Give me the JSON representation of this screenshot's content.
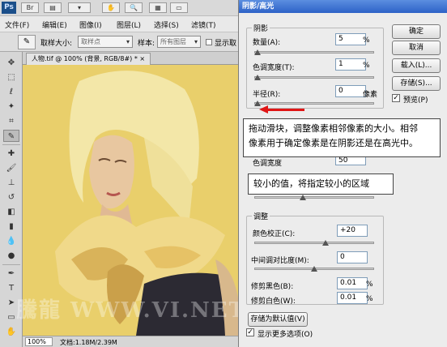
{
  "app": {
    "logo": "Ps",
    "menu": [
      "文件(F)",
      "编辑(E)",
      "图像(I)",
      "图层(L)",
      "选择(S)",
      "滤镜(T)"
    ]
  },
  "options": {
    "sample_size_label": "取样大小:",
    "sample_size_value": "取样点",
    "sample_label": "样本:",
    "sample_value": "所有图层",
    "show_ring_label": "显示取"
  },
  "document": {
    "tab_title": "人物.tif @ 100% (背景, RGB/8#) *",
    "zoom": "100%",
    "info": "文档:1.18M/2.39M"
  },
  "dialog": {
    "title": "阴影/高光",
    "shadow_group": "阴影",
    "amount_label": "数量(A):",
    "amount_value": "5",
    "amount_unit": "%",
    "tonal_label": "色调宽度(T):",
    "tonal_value": "1",
    "tonal_unit": "%",
    "radius_label": "半径(R):",
    "radius_value": "0",
    "radius_unit": "像素",
    "hl_partial_label": "色调宽度",
    "hl_partial_value": "50",
    "adjust_group": "调整",
    "color_label": "颜色校正(C):",
    "color_value": "+20",
    "midtone_label": "中间调对比度(M):",
    "midtone_value": "0",
    "black_clip_label": "修剪黑色(B):",
    "black_clip_value": "0.01",
    "black_clip_unit": "%",
    "white_clip_label": "修剪白色(W):",
    "white_clip_value": "0.01",
    "white_clip_unit": "%",
    "save_default": "存储为默认值(V)",
    "show_more": "显示更多选项(O)",
    "buttons": {
      "ok": "确定",
      "cancel": "取消",
      "load": "载入(L)...",
      "save": "存储(S)...",
      "preview": "预览(P)"
    }
  },
  "annotations": {
    "callout1_line1": "拖动滑块，调整像素相邻像素的大小。相邻",
    "callout1_line2": "像素用于确定像素是在阴影还是在高光中。",
    "callout2": "较小的值，将指定较小的区域"
  },
  "watermark": "騰龍 WWW.VI.NET",
  "colors": {
    "canvas_bg": "#e8ce6a",
    "arrow": "#e01515",
    "title_bar": "#2d62c7"
  }
}
